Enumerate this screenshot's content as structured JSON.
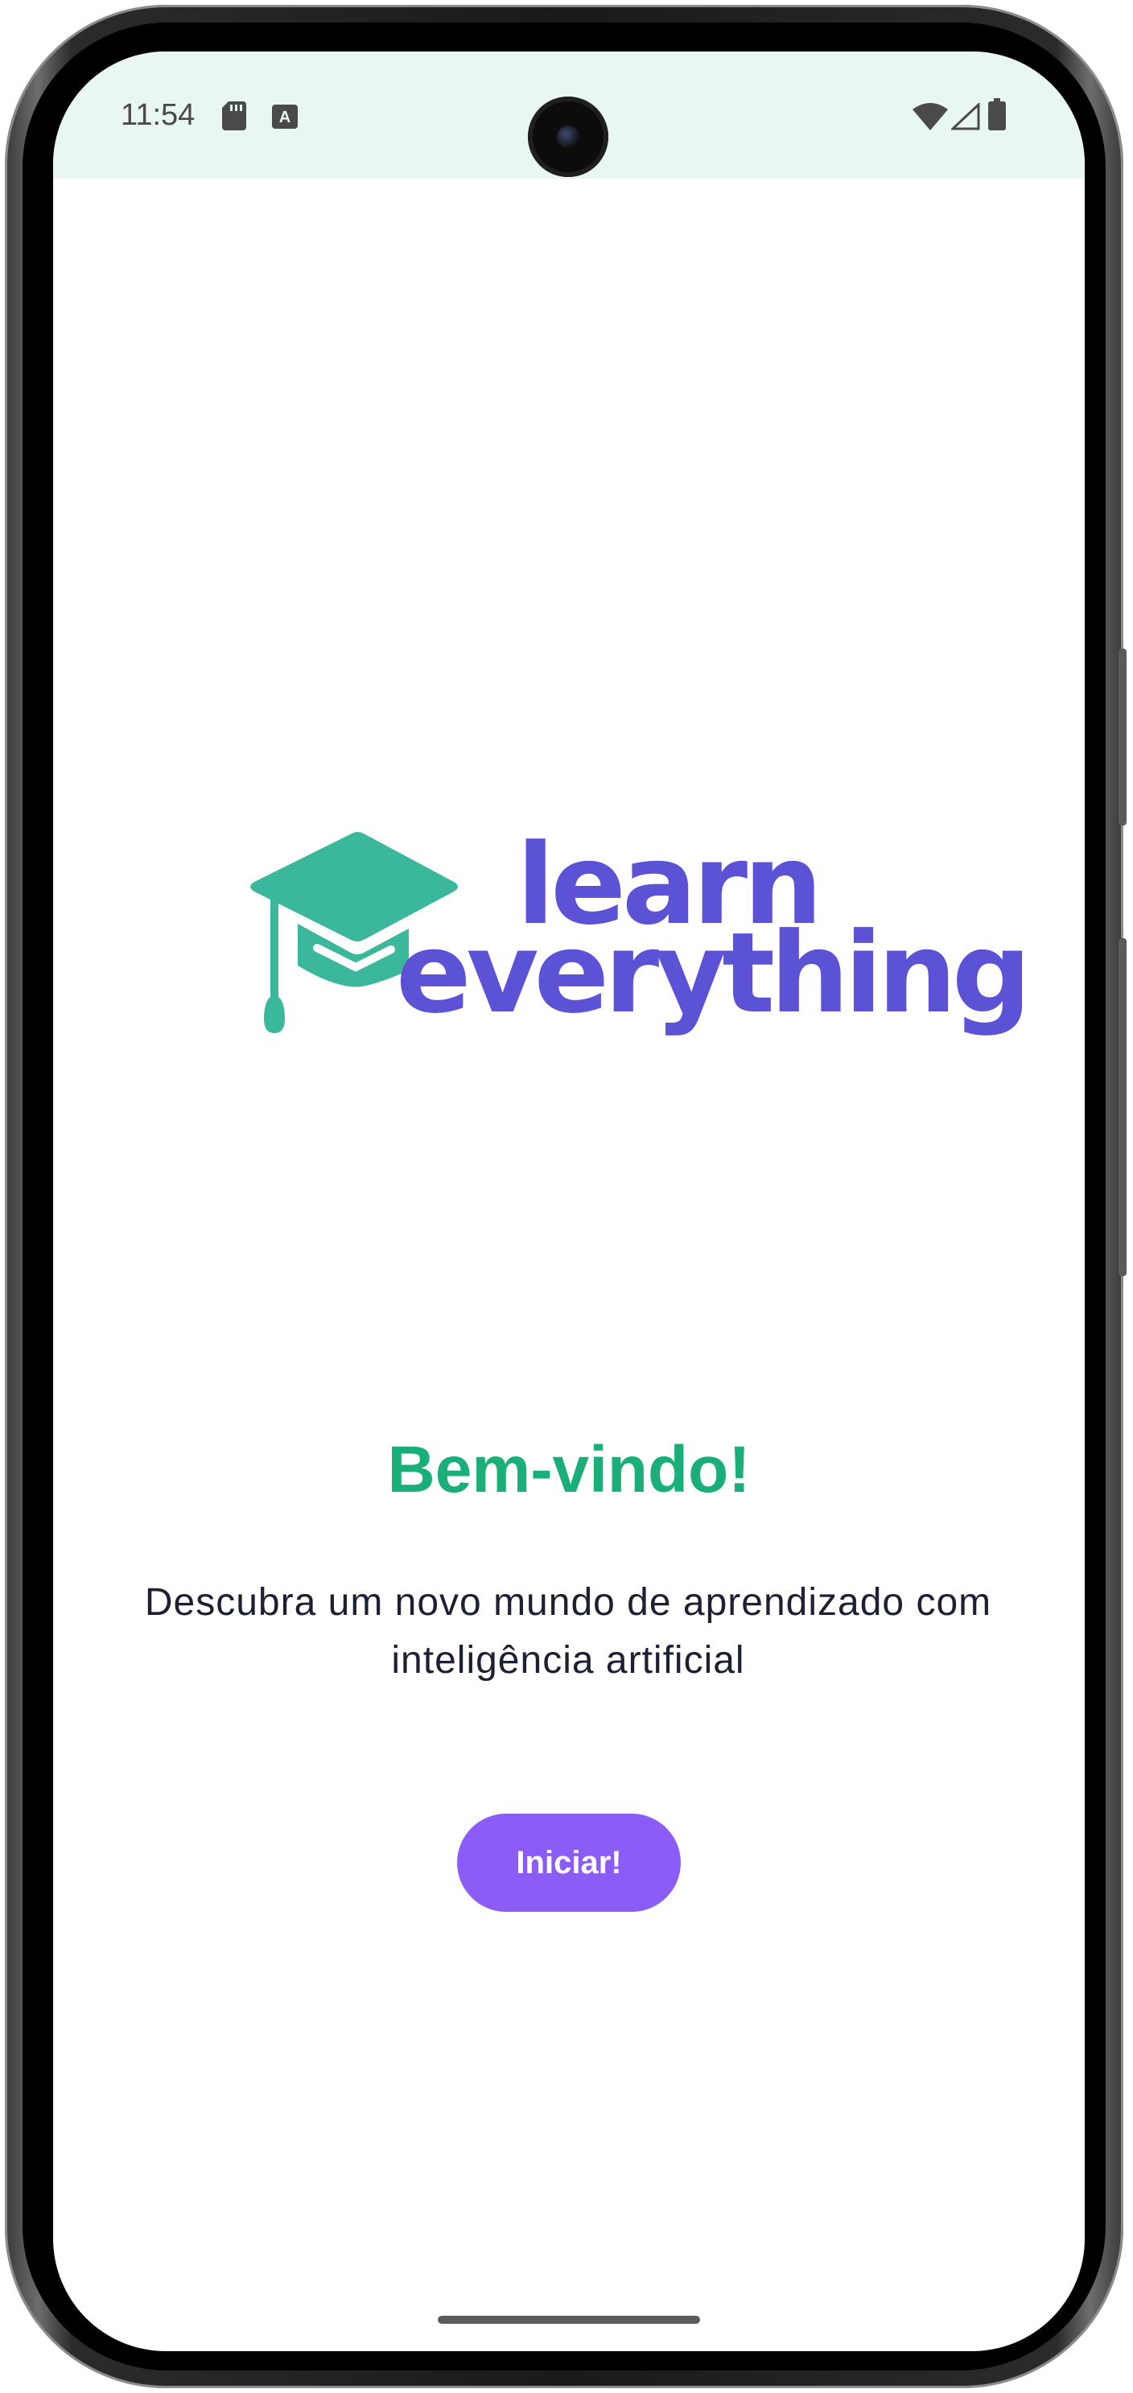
{
  "status_bar": {
    "time": "11:54",
    "left_icons": [
      "sd-card-icon",
      "keyboard-a-icon"
    ],
    "right_icons": [
      "wifi-icon",
      "signal-icon",
      "battery-icon"
    ]
  },
  "logo": {
    "line1": "learn",
    "line2": "everything",
    "icon": "graduation-cap-icon",
    "icon_color": "#3bb89b",
    "text_color": "#5b52d6"
  },
  "welcome": {
    "title": "Bem-vindo!",
    "subtitle": "Descubra um novo mundo de aprendizado com inteligência artificial",
    "title_color": "#1aaf78"
  },
  "actions": {
    "start_label": "Iniciar!",
    "button_color": "#8b5cf6"
  }
}
